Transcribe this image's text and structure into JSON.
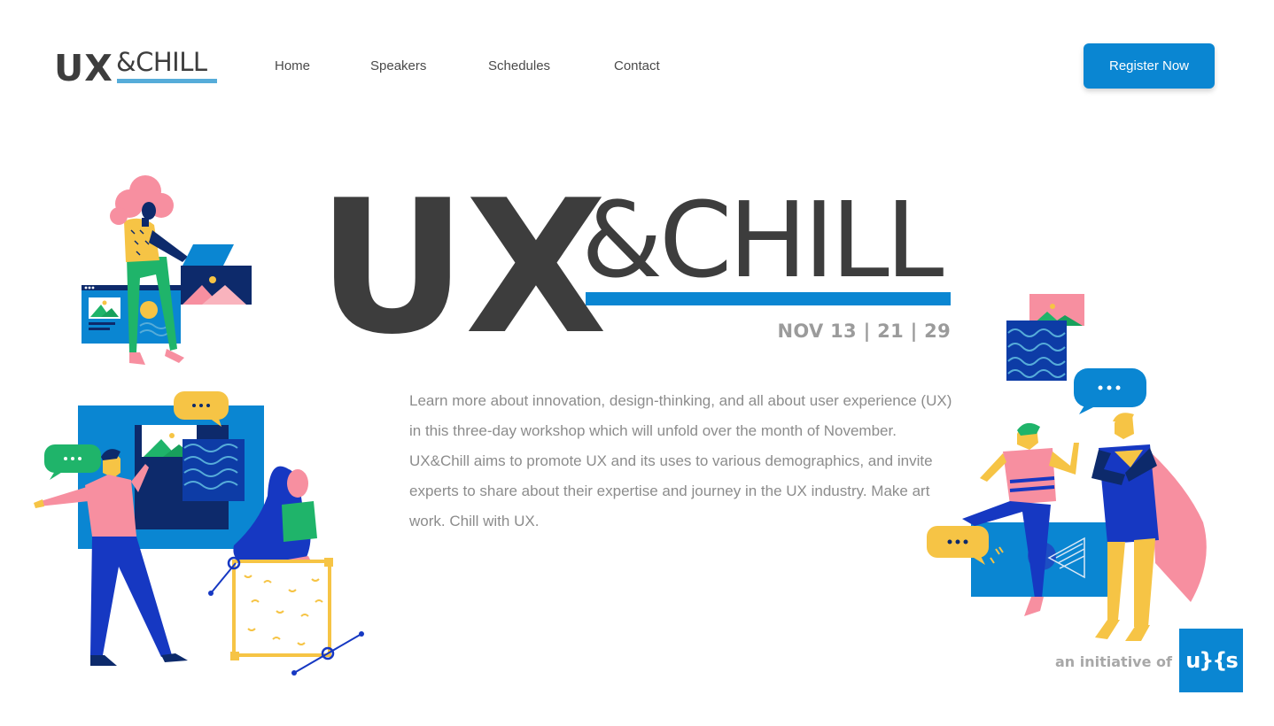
{
  "brand": {
    "logo_ux": "UX",
    "logo_chill": "&CHILL"
  },
  "nav": {
    "items": [
      {
        "label": "Home"
      },
      {
        "label": "Speakers"
      },
      {
        "label": "Schedules"
      },
      {
        "label": "Contact"
      }
    ]
  },
  "header": {
    "register_label": "Register Now"
  },
  "hero": {
    "title_ux": "UX",
    "title_chill": "&CHILL",
    "dates": "NOV 13 | 21 | 29",
    "description": "Learn more about innovation, design-thinking, and all about user experience (UX) in this three-day workshop which will unfold over the month of November. UX&Chill aims to promote UX and its uses to various demographics, and invite experts to share about their expertise and journey in the UX industry. Make art work. Chill with UX."
  },
  "footer": {
    "initiative_text": "an initiative of",
    "partner_logo_text": "u}{s"
  },
  "colors": {
    "brand_blue": "#0a86d2",
    "logo_underline": "#56acd9",
    "text_dark": "#3d3d3d",
    "text_muted": "#8c8c8c",
    "pink": "#f78fa0",
    "yellow": "#f6c445",
    "green": "#1fb46a",
    "navy": "#0d2a6b"
  }
}
